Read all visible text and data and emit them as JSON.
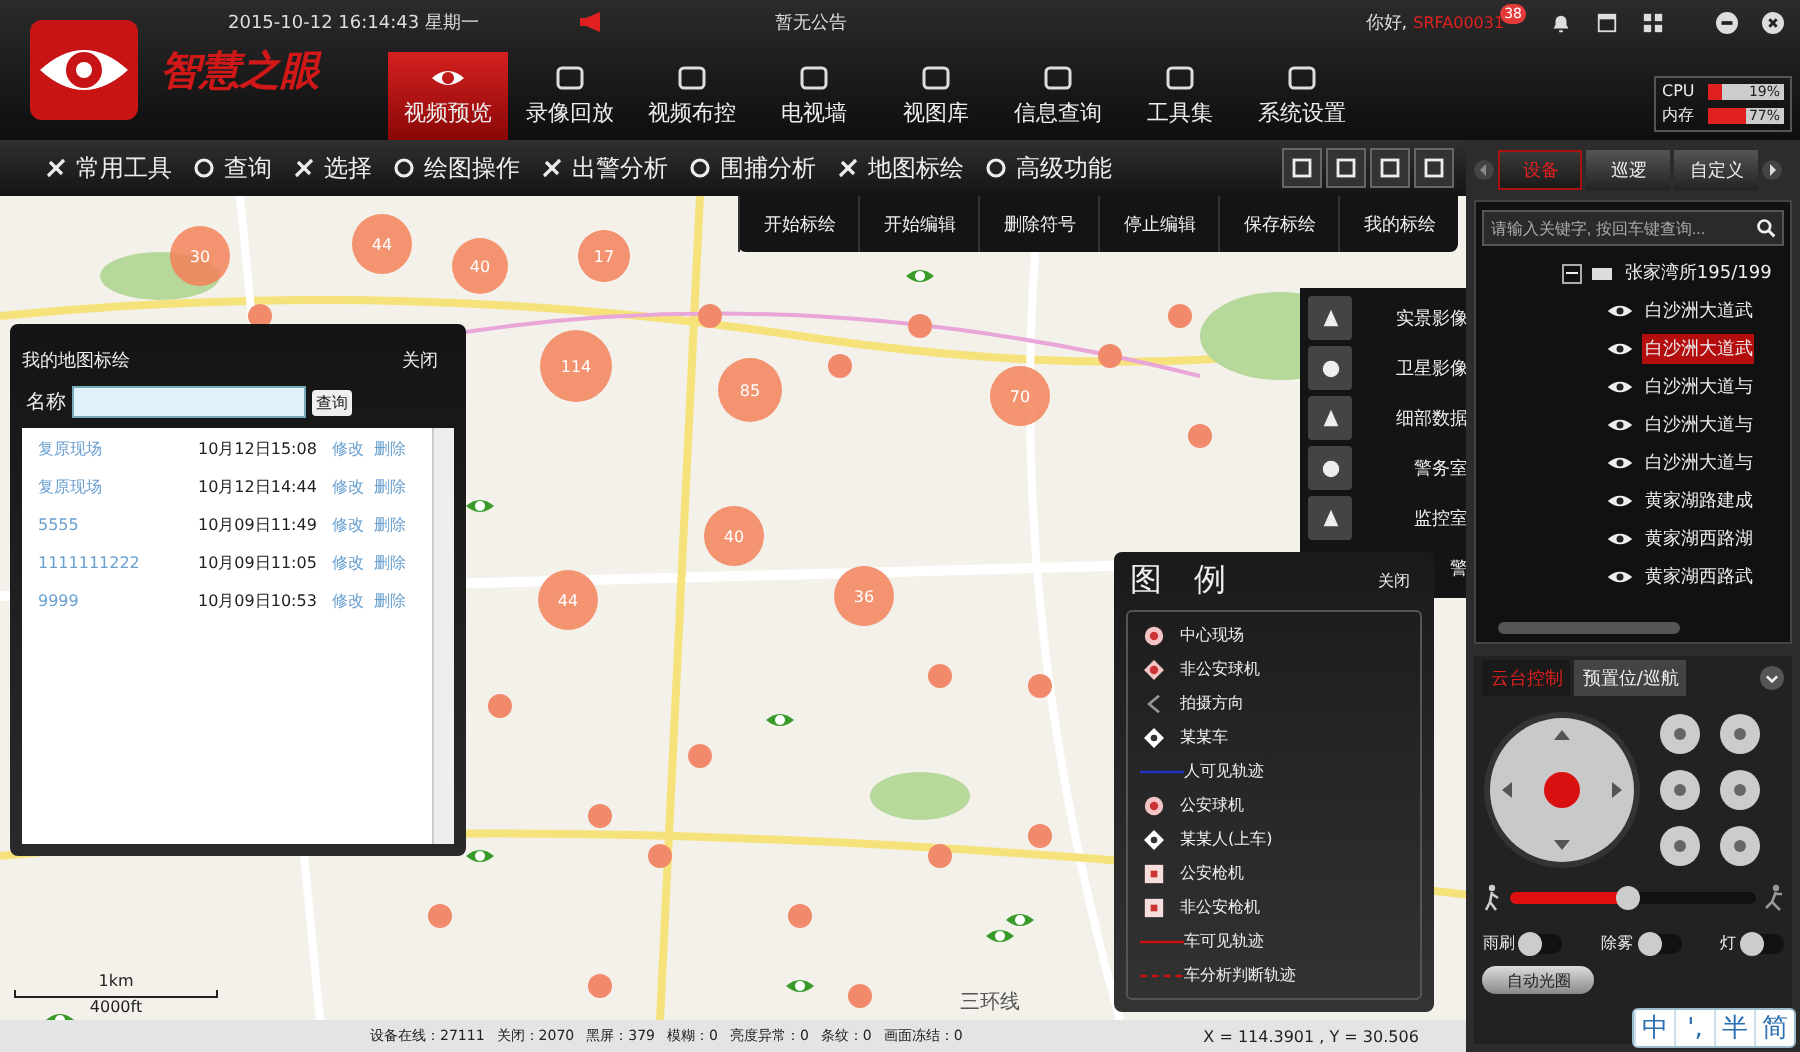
{
  "header": {
    "logo_text": "智慧之眼",
    "datetime": "2015-10-12 16:14:43 星期一",
    "announcement": "暂无公告",
    "greeting": "你好,",
    "username": "SRFA00031",
    "notification_count": "38"
  },
  "nav_tabs": [
    {
      "label": "视频预览",
      "selected": true
    },
    {
      "label": "录像回放",
      "selected": false
    },
    {
      "label": "视频布控",
      "selected": false
    },
    {
      "label": "电视墙",
      "selected": false
    },
    {
      "label": "视图库",
      "selected": false
    },
    {
      "label": "信息查询",
      "selected": false
    },
    {
      "label": "工具集",
      "selected": false
    },
    {
      "label": "系统设置",
      "selected": false
    }
  ],
  "system_meters": [
    {
      "label": "CPU",
      "reading": "19%",
      "level": 0.19
    },
    {
      "label": "内存",
      "reading": "77%",
      "level": 0.77
    }
  ],
  "toolbar": {
    "items": [
      "常用工具",
      "查询",
      "选择",
      "绘图操作",
      "出警分析",
      "围捕分析",
      "地图标绘",
      "高级功能"
    ],
    "submenu": [
      "开始标绘",
      "开始编辑",
      "删除符号",
      "停止编辑",
      "保存标绘",
      "我的标绘"
    ]
  },
  "map": {
    "clusters": [
      "44",
      "30",
      "17",
      "40",
      "114",
      "85",
      "70",
      "40",
      "44",
      "36"
    ],
    "road_labels": [
      "三环线"
    ],
    "side_buttons": [
      "实景影像",
      "卫星影像",
      "细部数据",
      "警务室",
      "监控室",
      "警"
    ],
    "scale": {
      "metric": "1km",
      "imperial": "4000ft"
    }
  },
  "plot_panel": {
    "title": "我的地图标绘",
    "close": "关闭",
    "name_label": "名称",
    "search_button": "查询",
    "rows": [
      {
        "name": "复原现场",
        "time": "10月12日15:08",
        "edit": "修改",
        "delete": "删除"
      },
      {
        "name": "复原现场",
        "time": "10月12日14:44",
        "edit": "修改",
        "delete": "删除"
      },
      {
        "name": "5555",
        "time": "10月09日11:49",
        "edit": "修改",
        "delete": "删除"
      },
      {
        "name": "1111111222",
        "time": "10月09日11:05",
        "edit": "修改",
        "delete": "删除"
      },
      {
        "name": "9999",
        "time": "10月09日10:53",
        "edit": "修改",
        "delete": "删除"
      }
    ]
  },
  "legend": {
    "title": "图　例",
    "close": "关闭",
    "items": [
      {
        "kind": "scene",
        "label": "中心现场"
      },
      {
        "kind": "dome",
        "label": "非公安球机"
      },
      {
        "kind": "direction",
        "label": "拍摄方向"
      },
      {
        "kind": "diamond",
        "label": "某某车"
      },
      {
        "kind": "line",
        "label": "人可见轨迹",
        "color": "#2233cc"
      },
      {
        "kind": "scene",
        "label": "公安球机"
      },
      {
        "kind": "diamond",
        "label": "某某人(上车)"
      },
      {
        "kind": "square",
        "label": "公安枪机"
      },
      {
        "kind": "square",
        "label": "非公安枪机"
      },
      {
        "kind": "line",
        "label": "车可见轨迹",
        "color": "#cc1111"
      },
      {
        "kind": "dashed",
        "label": "车分析判断轨迹",
        "color": "#cc1111"
      }
    ]
  },
  "status_bar": {
    "stats": [
      "设备在线：27111",
      "关闭：2070",
      "黑屏：379",
      "模糊：0",
      "亮度异常：0",
      "条纹：0",
      "画面冻结：0"
    ],
    "coordinates": "X = 114.3901 , Y = 30.506"
  },
  "right_panel": {
    "tabs": [
      {
        "label": "设备",
        "selected": true
      },
      {
        "label": "巡逻",
        "selected": false
      },
      {
        "label": "自定义",
        "selected": false
      }
    ],
    "search": {
      "placeholder": "请输入关键字, 按回车键查询..."
    },
    "tree": {
      "label": "张家湾所195/199",
      "expanded": true,
      "children": [
        {
          "label": "白沙洲大道武",
          "selected": false
        },
        {
          "label": "白沙洲大道武",
          "selected": true
        },
        {
          "label": "白沙洲大道与",
          "selected": false
        },
        {
          "label": "白沙洲大道与",
          "selected": false
        },
        {
          "label": "白沙洲大道与",
          "selected": false
        },
        {
          "label": "黄家湖路建成",
          "selected": false
        },
        {
          "label": "黄家湖西路湖",
          "selected": false
        },
        {
          "label": "黄家湖西路武",
          "selected": false
        }
      ]
    },
    "ptz_tabs": [
      {
        "label": "云台控制",
        "selected": true
      },
      {
        "label": "预置位/巡航",
        "selected": false
      }
    ],
    "speed": {
      "level": 0.48
    },
    "toggles": [
      {
        "label": "雨刷",
        "on": false
      },
      {
        "label": "除雾",
        "on": false
      },
      {
        "label": "灯",
        "on": false
      }
    ],
    "iris_button": "自动光圈"
  },
  "ime_bar": [
    "中",
    "',",
    "半",
    "简"
  ]
}
